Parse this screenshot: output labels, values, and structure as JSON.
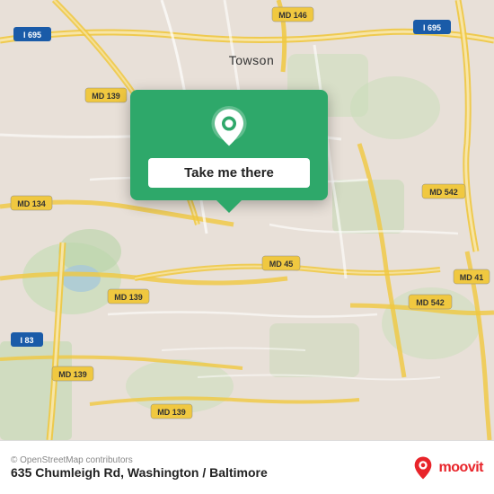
{
  "map": {
    "alt": "Map of Towson area near 635 Chumleigh Rd"
  },
  "popup": {
    "take_me_there_label": "Take me there"
  },
  "bottom_bar": {
    "copyright": "© OpenStreetMap contributors",
    "address": "635 Chumleigh Rd, Washington / Baltimore",
    "moovit_label": "moovit"
  },
  "road_labels": [
    "I 695",
    "MD 146",
    "I 695",
    "MD 139",
    "MD 134",
    "MD 45",
    "MD 542",
    "MD 41",
    "MD 139",
    "MD 139",
    "MD 542",
    "I 83",
    "Towson"
  ],
  "colors": {
    "map_bg": "#e8e0d8",
    "green_water": "#b8d8c8",
    "highway_yellow": "#f5d76e",
    "road_white": "#ffffff",
    "popup_green": "#2ea86a",
    "moovit_red": "#e8242a"
  }
}
